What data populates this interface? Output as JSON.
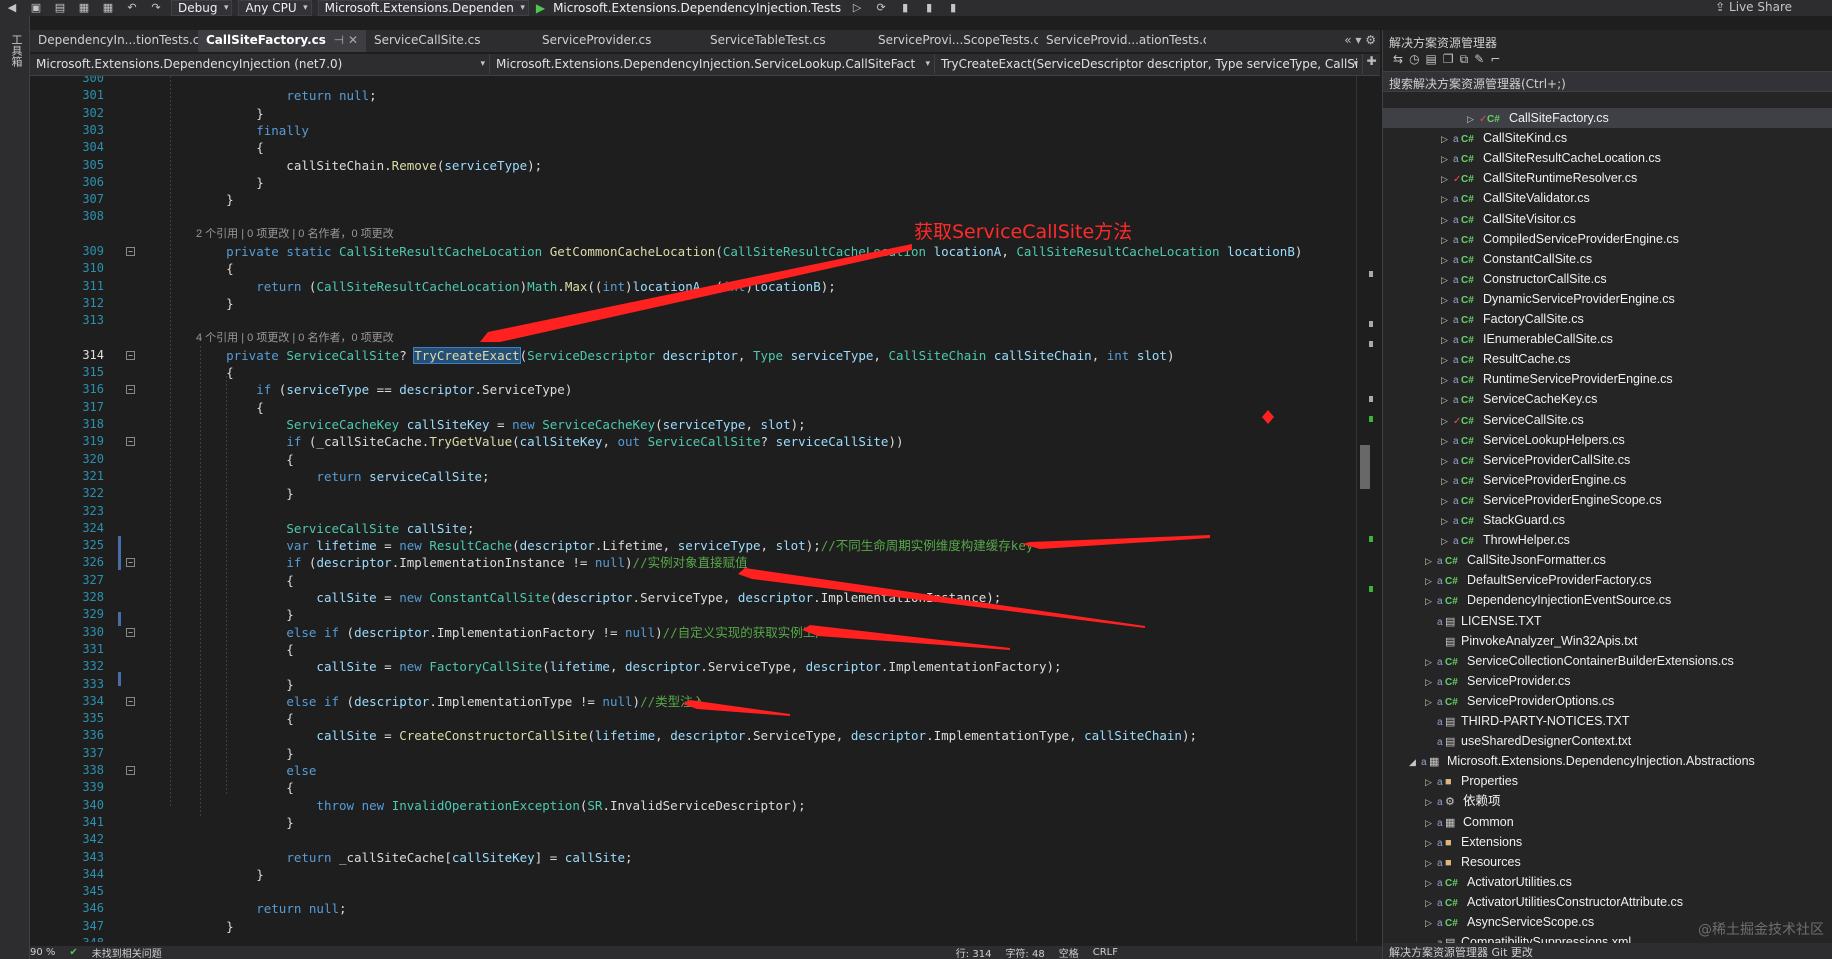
{
  "toolbar": {
    "config": "Debug",
    "platform": "Any CPU",
    "project": "Microsoft.Extensions.Dependen",
    "run_target": "Microsoft.Extensions.DependencyInjection.Tests",
    "live_share": "Live Share"
  },
  "left_strip": {
    "label": "工具箱"
  },
  "tabs": [
    {
      "label": "DependencyIn...tionTests.cs",
      "active": false
    },
    {
      "label": "CallSiteFactory.cs",
      "active": true
    },
    {
      "label": "ServiceCallSite.cs",
      "active": false
    },
    {
      "label": "ServiceProvider.cs",
      "active": false
    },
    {
      "label": "ServiceTableTest.cs",
      "active": false
    },
    {
      "label": "ServiceProvi...ScopeTests.cs",
      "active": false
    },
    {
      "label": "ServiceProvid...ationTests.cs",
      "active": false
    }
  ],
  "navbar": {
    "project": "Microsoft.Extensions.DependencyInjection (net7.0)",
    "type": "Microsoft.Extensions.DependencyInjection.ServiceLookup.CallSiteFact",
    "member": "TryCreateExact(ServiceDescriptor descriptor, Type serviceType, CallSi"
  },
  "annotation": {
    "title": "获取ServiceCallSite方法"
  },
  "code_lines": [
    {
      "n": "300",
      "html": ""
    },
    {
      "n": "301",
      "html": "            <span class='k'>return</span> <span class='k'>null</span>;"
    },
    {
      "n": "302",
      "html": "        }"
    },
    {
      "n": "303",
      "html": "        <span class='k'>finally</span>"
    },
    {
      "n": "304",
      "html": "        {"
    },
    {
      "n": "305",
      "html": "            callSiteChain.<span class='m'>Remove</span>(<span class='p'>serviceType</span>);"
    },
    {
      "n": "306",
      "html": "        }"
    },
    {
      "n": "307",
      "html": "    }"
    },
    {
      "n": "308",
      "html": ""
    },
    {
      "n": "",
      "lens": "2 个引用 | 0 项更改 | 0 名作者，0 项更改"
    },
    {
      "n": "309",
      "html": "    <span class='k'>private static</span> <span class='t'>CallSiteResultCacheLocation</span> <span class='m'>GetCommonCacheLocation</span>(<span class='t'>CallSiteResultCacheLocation</span> <span class='p'>locationA</span>, <span class='t'>CallSiteResultCacheLocation</span> <span class='p'>locationB</span>)"
    },
    {
      "n": "310",
      "html": "    {"
    },
    {
      "n": "311",
      "html": "        <span class='k'>return</span> (<span class='t'>CallSiteResultCacheLocation</span>)<span class='t'>Math</span>.<span class='m'>Max</span>((<span class='k'>int</span>)<span class='p'>locationA</span>, (<span class='k'>int</span>)<span class='p'>locationB</span>);"
    },
    {
      "n": "312",
      "html": "    }"
    },
    {
      "n": "313",
      "html": ""
    },
    {
      "n": "",
      "lens": "4 个引用 | 0 项更改 | 0 名作者，0 项更改"
    },
    {
      "n": "314",
      "cur": true,
      "html": "    <span class='k'>private</span> <span class='t'>ServiceCallSite</span>? <span class='hl'>TryCreateExact</span>(<span class='t'>ServiceDescriptor</span> <span class='p'>descriptor</span>, <span class='t'>Type</span> <span class='p'>serviceType</span>, <span class='t'>CallSiteChain</span> <span class='p'>callSiteChain</span>, <span class='k'>int</span> <span class='p'>slot</span>)"
    },
    {
      "n": "315",
      "html": "    {"
    },
    {
      "n": "316",
      "html": "        <span class='k'>if</span> (<span class='p'>serviceType</span> == <span class='p'>descriptor</span>.ServiceType)"
    },
    {
      "n": "317",
      "html": "        {"
    },
    {
      "n": "318",
      "html": "            <span class='t'>ServiceCacheKey</span> <span class='p'>callSiteKey</span> = <span class='k'>new</span> <span class='t'>ServiceCacheKey</span>(<span class='p'>serviceType</span>, <span class='p'>slot</span>);"
    },
    {
      "n": "319",
      "html": "            <span class='k'>if</span> (_callSiteCache.<span class='m'>TryGetValue</span>(<span class='p'>callSiteKey</span>, <span class='k'>out</span> <span class='t'>ServiceCallSite</span>? <span class='p'>serviceCallSite</span>))"
    },
    {
      "n": "320",
      "html": "            {"
    },
    {
      "n": "321",
      "html": "                <span class='k'>return</span> <span class='p'>serviceCallSite</span>;"
    },
    {
      "n": "322",
      "html": "            }"
    },
    {
      "n": "323",
      "html": ""
    },
    {
      "n": "324",
      "html": "            <span class='t'>ServiceCallSite</span> <span class='p'>callSite</span>;"
    },
    {
      "n": "325",
      "html": "            <span class='k'>var</span> <span class='p'>lifetime</span> = <span class='k'>new</span> <span class='t'>ResultCache</span>(<span class='p'>descriptor</span>.Lifetime, <span class='p'>serviceType</span>, <span class='p'>slot</span>);<span class='c'>//不同生命周期实例维度构建缓存key</span>"
    },
    {
      "n": "326",
      "html": "            <span class='k'>if</span> (<span class='p'>descriptor</span>.ImplementationInstance != <span class='k'>null</span>)<span class='c'>//实例对象直接赋值</span>"
    },
    {
      "n": "327",
      "html": "            {"
    },
    {
      "n": "328",
      "html": "                <span class='p'>callSite</span> = <span class='k'>new</span> <span class='t'>ConstantCallSite</span>(<span class='p'>descriptor</span>.ServiceType, <span class='p'>descriptor</span>.ImplementationInstance);"
    },
    {
      "n": "329",
      "html": "            }"
    },
    {
      "n": "330",
      "html": "            <span class='k'>else if</span> (<span class='p'>descriptor</span>.ImplementationFactory != <span class='k'>null</span>)<span class='c'>//自定义实现的获取实例工厂</span>"
    },
    {
      "n": "331",
      "html": "            {"
    },
    {
      "n": "332",
      "html": "                <span class='p'>callSite</span> = <span class='k'>new</span> <span class='t'>FactoryCallSite</span>(<span class='p'>lifetime</span>, <span class='p'>descriptor</span>.ServiceType, <span class='p'>descriptor</span>.ImplementationFactory);"
    },
    {
      "n": "333",
      "html": "            }"
    },
    {
      "n": "334",
      "html": "            <span class='k'>else if</span> (<span class='p'>descriptor</span>.ImplementationType != <span class='k'>null</span>)<span class='c'>//类型注入</span>"
    },
    {
      "n": "335",
      "html": "            {"
    },
    {
      "n": "336",
      "html": "                <span class='p'>callSite</span> = <span class='m'>CreateConstructorCallSite</span>(<span class='p'>lifetime</span>, <span class='p'>descriptor</span>.ServiceType, <span class='p'>descriptor</span>.ImplementationType, <span class='p'>callSiteChain</span>);"
    },
    {
      "n": "337",
      "html": "            }"
    },
    {
      "n": "338",
      "html": "            <span class='k'>else</span>"
    },
    {
      "n": "339",
      "html": "            {"
    },
    {
      "n": "340",
      "html": "                <span class='k'>throw</span> <span class='k'>new</span> <span class='t'>InvalidOperationException</span>(<span class='t'>SR</span>.InvalidServiceDescriptor);"
    },
    {
      "n": "341",
      "html": "            }"
    },
    {
      "n": "342",
      "html": ""
    },
    {
      "n": "343",
      "html": "            <span class='k'>return</span> _callSiteCache[<span class='p'>callSiteKey</span>] = <span class='p'>callSite</span>;"
    },
    {
      "n": "344",
      "html": "        }"
    },
    {
      "n": "345",
      "html": ""
    },
    {
      "n": "346",
      "html": "        <span class='k'>return</span> <span class='k'>null</span>;"
    },
    {
      "n": "347",
      "html": "    }"
    },
    {
      "n": "348",
      "html": ""
    }
  ],
  "solution_explorer": {
    "title": "解决方案资源管理器",
    "search_placeholder": "搜索解决方案资源管理器(Ctrl+;)",
    "items": [
      {
        "label": "CallSiteFactory.cs",
        "kind": "cs",
        "indent": 2,
        "checked": true,
        "selected": true
      },
      {
        "label": "CallSiteKind.cs",
        "kind": "cs",
        "indent": 2
      },
      {
        "label": "CallSiteResultCacheLocation.cs",
        "kind": "cs",
        "indent": 2
      },
      {
        "label": "CallSiteRuntimeResolver.cs",
        "kind": "cs",
        "indent": 2,
        "checked": true
      },
      {
        "label": "CallSiteValidator.cs",
        "kind": "cs",
        "indent": 2
      },
      {
        "label": "CallSiteVisitor.cs",
        "kind": "cs",
        "indent": 2
      },
      {
        "label": "CompiledServiceProviderEngine.cs",
        "kind": "cs",
        "indent": 2
      },
      {
        "label": "ConstantCallSite.cs",
        "kind": "cs",
        "indent": 2
      },
      {
        "label": "ConstructorCallSite.cs",
        "kind": "cs",
        "indent": 2
      },
      {
        "label": "DynamicServiceProviderEngine.cs",
        "kind": "cs",
        "indent": 2
      },
      {
        "label": "FactoryCallSite.cs",
        "kind": "cs",
        "indent": 2
      },
      {
        "label": "IEnumerableCallSite.cs",
        "kind": "cs",
        "indent": 2
      },
      {
        "label": "ResultCache.cs",
        "kind": "cs",
        "indent": 2
      },
      {
        "label": "RuntimeServiceProviderEngine.cs",
        "kind": "cs",
        "indent": 2
      },
      {
        "label": "ServiceCacheKey.cs",
        "kind": "cs",
        "indent": 2
      },
      {
        "label": "ServiceCallSite.cs",
        "kind": "cs",
        "indent": 2,
        "checked": true
      },
      {
        "label": "ServiceLookupHelpers.cs",
        "kind": "cs",
        "indent": 2
      },
      {
        "label": "ServiceProviderCallSite.cs",
        "kind": "cs",
        "indent": 2
      },
      {
        "label": "ServiceProviderEngine.cs",
        "kind": "cs",
        "indent": 2
      },
      {
        "label": "ServiceProviderEngineScope.cs",
        "kind": "cs",
        "indent": 2
      },
      {
        "label": "StackGuard.cs",
        "kind": "cs",
        "indent": 2
      },
      {
        "label": "ThrowHelper.cs",
        "kind": "cs",
        "indent": 2
      },
      {
        "label": "CallSiteJsonFormatter.cs",
        "kind": "cs",
        "indent": 1
      },
      {
        "label": "DefaultServiceProviderFactory.cs",
        "kind": "cs",
        "indent": 1
      },
      {
        "label": "DependencyInjectionEventSource.cs",
        "kind": "cs",
        "indent": 1
      },
      {
        "label": "LICENSE.TXT",
        "kind": "file",
        "indent": 1,
        "leaf": true
      },
      {
        "label": "PinvokeAnalyzer_Win32Apis.txt",
        "kind": "file",
        "indent": 1,
        "leaf": true,
        "nolock": true
      },
      {
        "label": "ServiceCollectionContainerBuilderExtensions.cs",
        "kind": "cs",
        "indent": 1
      },
      {
        "label": "ServiceProvider.cs",
        "kind": "cs",
        "indent": 1
      },
      {
        "label": "ServiceProviderOptions.cs",
        "kind": "cs",
        "indent": 1
      },
      {
        "label": "THIRD-PARTY-NOTICES.TXT",
        "kind": "file",
        "indent": 1,
        "leaf": true
      },
      {
        "label": "useSharedDesignerContext.txt",
        "kind": "file",
        "indent": 1,
        "leaf": true
      },
      {
        "label": "Microsoft.Extensions.DependencyInjection.Abstractions",
        "kind": "proj",
        "indent": 0,
        "expanded": true
      },
      {
        "label": "Properties",
        "kind": "folder",
        "indent": 1
      },
      {
        "label": "依赖项",
        "kind": "deps",
        "indent": 1
      },
      {
        "label": "Common",
        "kind": "proj",
        "indent": 1
      },
      {
        "label": "Extensions",
        "kind": "folder",
        "indent": 1
      },
      {
        "label": "Resources",
        "kind": "folder",
        "indent": 1
      },
      {
        "label": "ActivatorUtilities.cs",
        "kind": "cs",
        "indent": 1
      },
      {
        "label": "ActivatorUtilitiesConstructorAttribute.cs",
        "kind": "cs",
        "indent": 1
      },
      {
        "label": "AsyncServiceScope.cs",
        "kind": "cs",
        "indent": 1
      },
      {
        "label": "CompatibilitySuppressions.xml",
        "kind": "file",
        "indent": 1,
        "leaf": true
      }
    ],
    "bottom_tabs": "解决方案资源管理器   Git 更改",
    "watermark": "@稀土掘金技术社区"
  },
  "status": {
    "zoom": "90 %",
    "issues": "未找到相关问题",
    "line": "行: 314",
    "char": "字符: 48",
    "mode": "空格",
    "eol": "CRLF"
  },
  "colors": {
    "annotation_red": "#ff2020",
    "keyword": "#569cd6",
    "type": "#4ec9b0",
    "comment": "#57a64a"
  }
}
